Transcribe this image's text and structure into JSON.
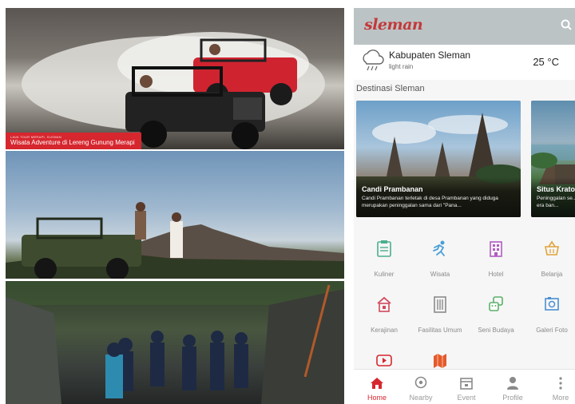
{
  "photos": {
    "jeep": {
      "caption_small": "LAVA TOUR MERAPI, SLEMAN",
      "caption_main": "Wisata Adventure di Lereng Gunung Merapi"
    }
  },
  "app": {
    "brand": "sleman",
    "brand_color": "#c23a3a",
    "header_color": "#bcc3c5",
    "accent_color": "#d6262e",
    "weather": {
      "location": "Kabupaten Sleman",
      "condition": "light rain",
      "temperature": "25 °C",
      "icon": "cloud-rain-icon"
    },
    "section_title": "Destinasi Sleman",
    "cards": [
      {
        "title": "Candi Prambanan",
        "description": "Candi Prambanan terletak di desa Prambanan yang diduga merupakan peninggalan sama dari \"Pana..."
      },
      {
        "title": "Situs Krato",
        "description": "Peninggalan se... situs era ban..."
      }
    ],
    "categories": [
      {
        "label": "Kuliner",
        "icon": "clipboard-icon",
        "color": "#4cae8c"
      },
      {
        "label": "Wisata",
        "icon": "person-run-icon",
        "color": "#4aa0d8"
      },
      {
        "label": "Hotel",
        "icon": "hotel-icon",
        "color": "#b05dc2"
      },
      {
        "label": "Belanja",
        "icon": "basket-icon",
        "color": "#e0a43a"
      },
      {
        "label": "Kerajinan",
        "icon": "house-icon",
        "color": "#d04a5c"
      },
      {
        "label": "Fasilitas Umum",
        "icon": "building-icon",
        "color": "#8a8a8a"
      },
      {
        "label": "Seni Budaya",
        "icon": "masks-icon",
        "color": "#5bb06a"
      },
      {
        "label": "Galeri Foto",
        "icon": "photo-icon",
        "color": "#4a8fd0"
      },
      {
        "label": "",
        "icon": "youtube-icon",
        "color": "#d6262e"
      },
      {
        "label": "",
        "icon": "map-icon",
        "color": "#e45a2c"
      }
    ],
    "nav": [
      {
        "label": "Home",
        "icon": "home-icon"
      },
      {
        "label": "Nearby",
        "icon": "location-pin-icon"
      },
      {
        "label": "Event",
        "icon": "calendar-icon"
      },
      {
        "label": "Profile",
        "icon": "person-icon"
      },
      {
        "label": "More",
        "icon": "more-vertical-icon"
      }
    ]
  }
}
